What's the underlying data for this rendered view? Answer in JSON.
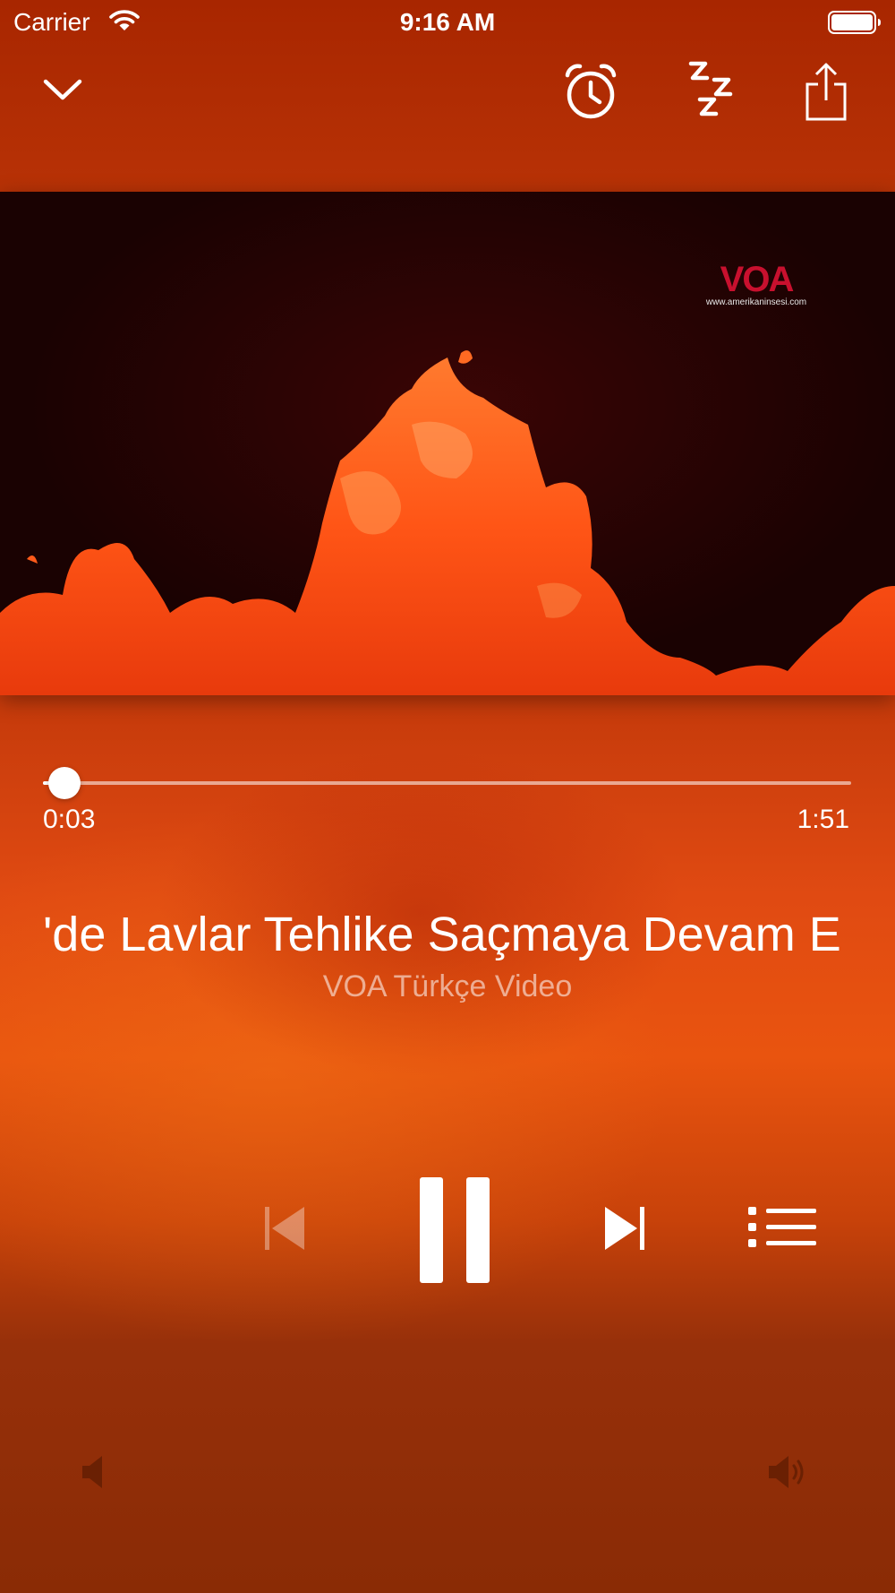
{
  "status_bar": {
    "carrier": "Carrier",
    "time": "9:16 AM",
    "icons": [
      "wifi-icon",
      "battery-icon"
    ]
  },
  "toolbar": {
    "icons": [
      "chevron-down-icon",
      "alarm-clock-icon",
      "sleep-zzz-icon",
      "share-icon"
    ]
  },
  "video": {
    "logo_text": "VOA",
    "logo_url": "www.amerikaninsesi.com"
  },
  "progress": {
    "elapsed": "0:03",
    "total": "1:51",
    "fraction": 0.027
  },
  "now_playing": {
    "title": "'de Lavlar Tehlike Saçmaya Devam E",
    "subtitle": "VOA Türkçe Video"
  },
  "controls": {
    "icons": [
      "previous-track-icon",
      "pause-icon",
      "next-track-icon",
      "queue-list-icon"
    ],
    "prev_enabled": false
  },
  "volume": {
    "icons": [
      "volume-low-icon",
      "volume-high-icon"
    ]
  },
  "colors": {
    "background_top": "#a82600",
    "background_mid": "#e9540f",
    "background_bottom": "#8a2b05",
    "lava": "#ff5a1a",
    "icon": "#ffffff"
  }
}
